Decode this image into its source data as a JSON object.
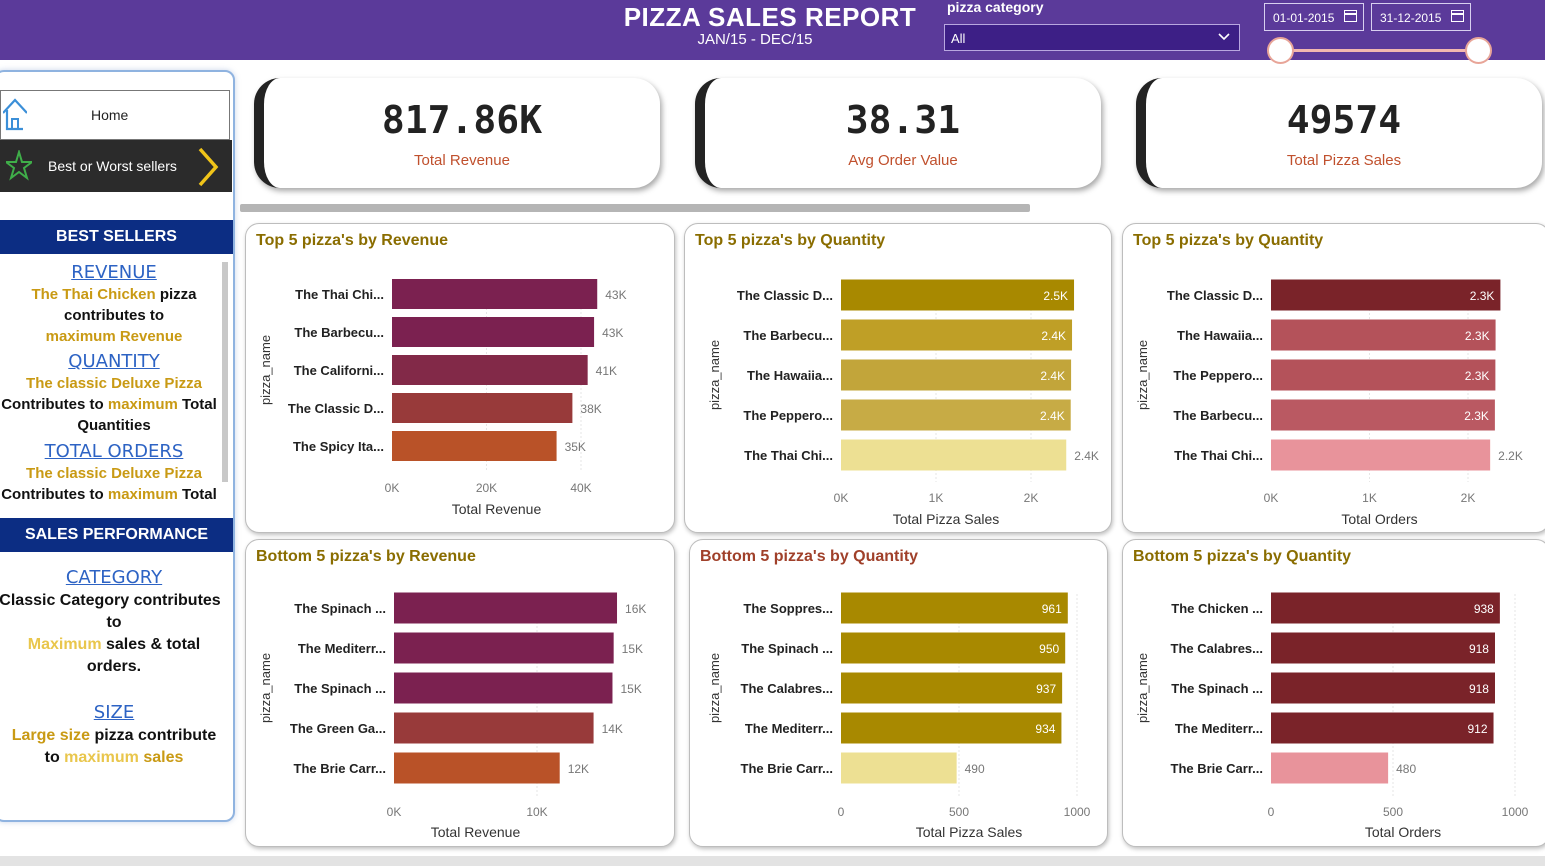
{
  "header": {
    "title": "PIZZA SALES REPORT",
    "subtitle": "JAN/15 - DEC/15",
    "category_label": "pizza category",
    "category_value": "All",
    "date_start": "01-01-2015",
    "date_end": "31-12-2015",
    "date_range_start_fraction": 0,
    "date_range_end_fraction": 1
  },
  "sidebar": {
    "nav_home": "Home",
    "nav_best": "Best or Worst sellers",
    "best_sellers_head": "BEST SELLERS",
    "revenue_link": "REVENUE",
    "revenue_line1_gold": "The Thai Chicken",
    "revenue_line1_rest": " pizza",
    "revenue_line2": "contributes to",
    "revenue_line3": "maximum Revenue",
    "quantity_link": "QUANTITY",
    "quantity_line1": "The classic Deluxe Pizza",
    "quantity_line2a": "Contributes to ",
    "quantity_line2b": "maximum",
    "quantity_line2c": " Total",
    "quantity_line3": "Quantities",
    "orders_link": "TOTAL ORDERS",
    "orders_line1": "The classic Deluxe Pizza",
    "orders_line2a": "Contributes to ",
    "orders_line2b": "maximum",
    "orders_line2c": " Total",
    "sales_perf_head": "SALES PERFORMANCE",
    "category_link": "CATEGORY",
    "category_line1a": "Classic Category",
    "category_line1b": " contributes",
    "category_line2": "to",
    "category_line3a": "Maximum",
    "category_line3b": " sales & total",
    "category_line4": "orders.",
    "size_link": "SIZE",
    "size_line1a": "Large size",
    "size_line1b": " pizza contribute",
    "size_line2a": "to ",
    "size_line2b": "maximum",
    "size_line2c": " sales"
  },
  "kpis": [
    {
      "value": "817.86K",
      "label": "Total Revenue"
    },
    {
      "value": "38.31",
      "label": "Avg Order Value"
    },
    {
      "value": "49574",
      "label": "Total Pizza Sales"
    }
  ],
  "colors": {
    "header": "#5b3a9a",
    "navy": "#0c2d83",
    "title_gold": "#8a6d00",
    "title_rust": "#a0402a",
    "title_maroon": "#7a2a2a"
  },
  "chart_data": [
    {
      "type": "bar",
      "title": "Top 5 pizza's by Revenue",
      "xlabel": "Total Revenue",
      "ylabel": "pizza_name",
      "categories": [
        "The Thai Chi...",
        "The Barbecu...",
        "The Californi...",
        "The Classic D...",
        "The Spicy Ita..."
      ],
      "values": [
        43434,
        42768,
        41410,
        38180,
        34831
      ],
      "data_labels": [
        "43K",
        "43K",
        "41K",
        "38K",
        "35K"
      ],
      "colors": [
        "#7b2150",
        "#7b2150",
        "#822948",
        "#983a3a",
        "#b95228"
      ],
      "xlim": [
        0,
        40000
      ],
      "ticks": [
        0,
        20000,
        40000
      ],
      "tick_labels": [
        "0K",
        "20K",
        "40K"
      ]
    },
    {
      "type": "bar",
      "title": "Top 5 pizza's by Quantity",
      "xlabel": "Total Pizza Sales",
      "ylabel": "pizza_name",
      "categories": [
        "The Classic D...",
        "The Barbecu...",
        "The Hawaiia...",
        "The Peppero...",
        "The Thai Chi..."
      ],
      "values": [
        2453,
        2432,
        2422,
        2418,
        2371
      ],
      "data_labels": [
        "2.5K",
        "2.4K",
        "2.4K",
        "2.4K",
        "2.4K"
      ],
      "colors": [
        "#a88900",
        "#bf9f26",
        "#c2a53a",
        "#c7ab45",
        "#ede093"
      ],
      "xlim": [
        0,
        2000
      ],
      "ticks": [
        0,
        1000,
        2000
      ],
      "tick_labels": [
        "0K",
        "1K",
        "2K"
      ]
    },
    {
      "type": "bar",
      "title": "Top 5 pizza's by Quantity",
      "xlabel": "Total Orders",
      "ylabel": "pizza_name",
      "categories": [
        "The Classic D...",
        "The Hawaiia...",
        "The Peppero...",
        "The Barbecu...",
        "The Thai Chi..."
      ],
      "values": [
        2329,
        2280,
        2278,
        2273,
        2225
      ],
      "data_labels": [
        "2.3K",
        "2.3K",
        "2.3K",
        "2.3K",
        "2.2K"
      ],
      "colors": [
        "#7a2329",
        "#b4525a",
        "#b4525a",
        "#ba5962",
        "#e8939b"
      ],
      "xlim": [
        0,
        2000
      ],
      "ticks": [
        0,
        1000,
        2000
      ],
      "tick_labels": [
        "0K",
        "1K",
        "2K"
      ]
    },
    {
      "type": "bar",
      "title": "Bottom 5 pizza's by Revenue",
      "xlabel": "Total Revenue",
      "ylabel": "pizza_name",
      "categories": [
        "The Spinach ...",
        "The Mediterr...",
        "The Spinach ...",
        "The Green Ga...",
        "The Brie Carr..."
      ],
      "values": [
        15596,
        15361,
        15278,
        13956,
        11588
      ],
      "data_labels": [
        "16K",
        "15K",
        "15K",
        "14K",
        "12K"
      ],
      "colors": [
        "#7b2150",
        "#7b2150",
        "#7b2150",
        "#983a3a",
        "#b95228"
      ],
      "xlim": [
        0,
        10000
      ],
      "ticks": [
        0,
        10000
      ],
      "tick_labels": [
        "0K",
        "10K"
      ]
    },
    {
      "type": "bar",
      "title": "Bottom 5 pizza's by Quantity",
      "xlabel": "Total Pizza Sales",
      "ylabel": "pizza_name",
      "categories": [
        "The Soppres...",
        "The Spinach ...",
        "The Calabres...",
        "The Mediterr...",
        "The Brie Carr..."
      ],
      "values": [
        961,
        950,
        937,
        934,
        490
      ],
      "data_labels": [
        "961",
        "950",
        "937",
        "934",
        "490"
      ],
      "colors": [
        "#a88900",
        "#a88900",
        "#a88900",
        "#a88900",
        "#ede093"
      ],
      "xlim": [
        0,
        1000
      ],
      "ticks": [
        0,
        500,
        1000
      ],
      "tick_labels": [
        "0",
        "500",
        "1000"
      ]
    },
    {
      "type": "bar",
      "title": "Bottom 5 pizza's by Quantity",
      "xlabel": "Total Orders",
      "ylabel": "pizza_name",
      "categories": [
        "The Chicken ...",
        "The Calabres...",
        "The Spinach ...",
        "The Mediterr...",
        "The Brie Carr..."
      ],
      "values": [
        938,
        918,
        918,
        912,
        480
      ],
      "data_labels": [
        "938",
        "918",
        "918",
        "912",
        "480"
      ],
      "colors": [
        "#7a2329",
        "#7a2329",
        "#7a2329",
        "#7a2329",
        "#e8939b"
      ],
      "xlim": [
        0,
        1000
      ],
      "ticks": [
        0,
        500,
        1000
      ],
      "tick_labels": [
        "0",
        "500",
        "1000"
      ]
    }
  ]
}
